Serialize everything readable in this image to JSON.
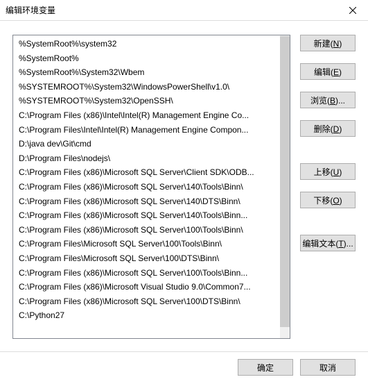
{
  "title": "编辑环境变量",
  "list": [
    "%SystemRoot%\\system32",
    "%SystemRoot%",
    "%SystemRoot%\\System32\\Wbem",
    "%SYSTEMROOT%\\System32\\WindowsPowerShell\\v1.0\\",
    "%SYSTEMROOT%\\System32\\OpenSSH\\",
    "C:\\Program Files (x86)\\Intel\\Intel(R) Management Engine Co...",
    "C:\\Program Files\\Intel\\Intel(R) Management Engine Compon...",
    "D:\\java dev\\Git\\cmd",
    "D:\\Program Files\\nodejs\\",
    "C:\\Program Files (x86)\\Microsoft SQL Server\\Client SDK\\ODB...",
    "C:\\Program Files (x86)\\Microsoft SQL Server\\140\\Tools\\Binn\\",
    "C:\\Program Files (x86)\\Microsoft SQL Server\\140\\DTS\\Binn\\",
    "C:\\Program Files (x86)\\Microsoft SQL Server\\140\\Tools\\Binn...",
    "C:\\Program Files (x86)\\Microsoft SQL Server\\100\\Tools\\Binn\\",
    "C:\\Program Files\\Microsoft SQL Server\\100\\Tools\\Binn\\",
    "C:\\Program Files\\Microsoft SQL Server\\100\\DTS\\Binn\\",
    "C:\\Program Files (x86)\\Microsoft SQL Server\\100\\Tools\\Binn...",
    "C:\\Program Files (x86)\\Microsoft Visual Studio 9.0\\Common7...",
    "C:\\Program Files (x86)\\Microsoft SQL Server\\100\\DTS\\Binn\\",
    "C:\\Python27"
  ],
  "buttons": {
    "new": "新建(N)",
    "edit": "编辑(E)",
    "browse": "浏览(B)...",
    "delete": "删除(D)",
    "moveup": "上移(U)",
    "movedown": "下移(O)",
    "edittext": "编辑文本(T)..."
  },
  "footer": {
    "ok": "确定",
    "cancel": "取消"
  }
}
